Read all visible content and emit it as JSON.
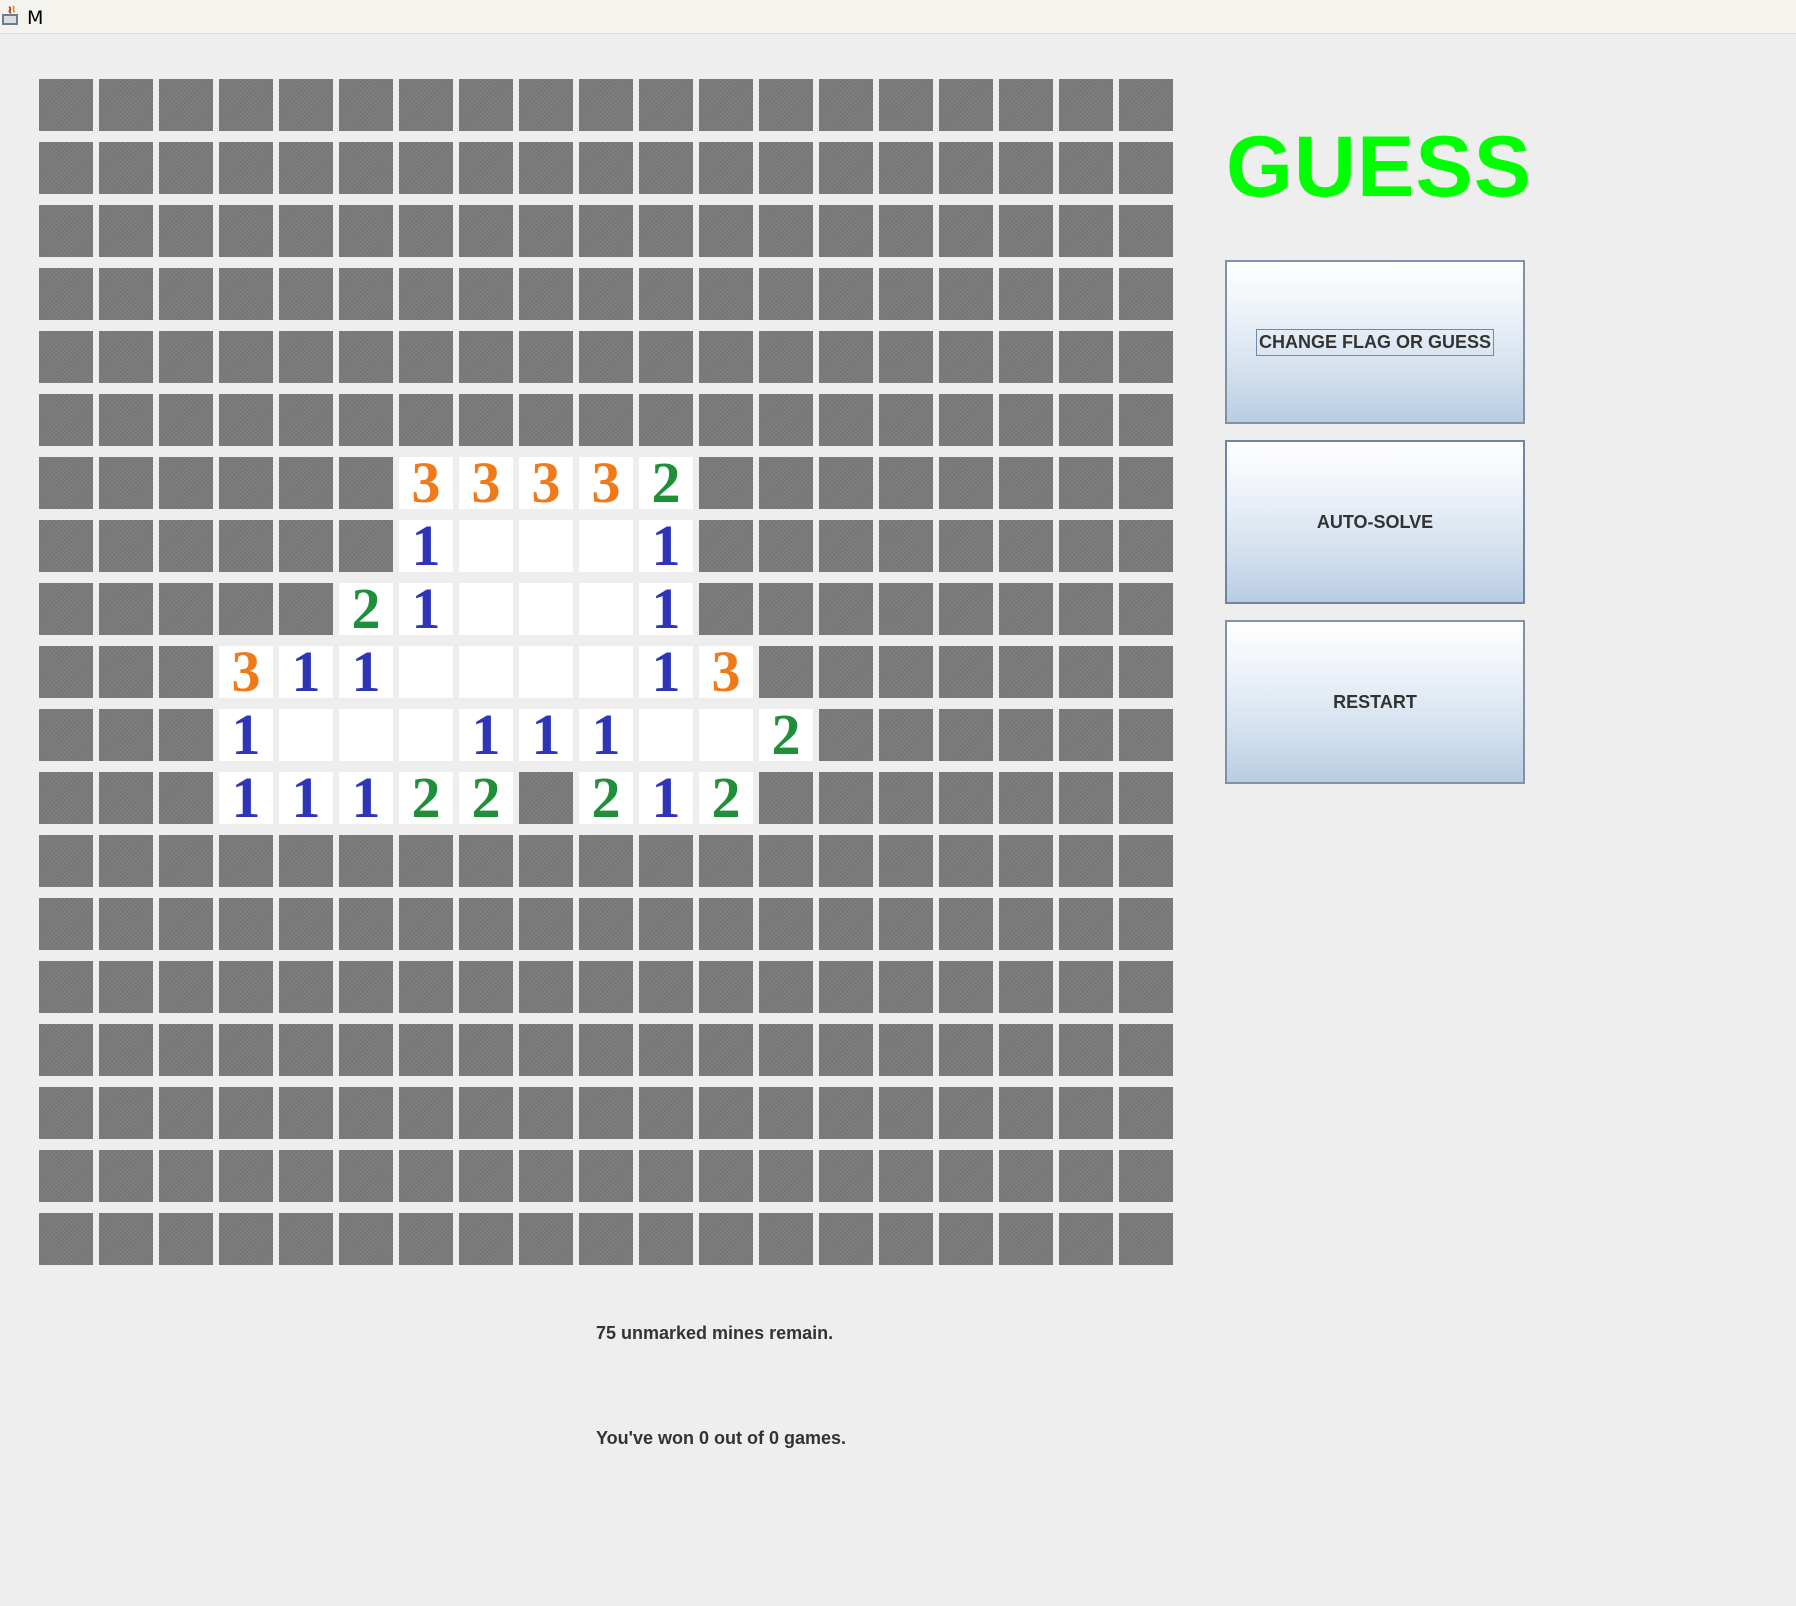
{
  "window": {
    "title": "M"
  },
  "mode": {
    "label": "GUESS",
    "color": "#00ff00"
  },
  "buttons": {
    "flag_toggle": "CHANGE FLAG OR GUESS",
    "auto_solve": "AUTO-SOLVE",
    "restart": "RESTART"
  },
  "status": {
    "mines_remaining": "75 unmarked mines remain.",
    "games_won": "You've won 0 out of 0 games."
  },
  "colors": {
    "hidden_cell": "#7a7a7a",
    "open_cell": "#ffffff",
    "number_1": "#2e35b8",
    "number_2": "#1f8f3a",
    "number_3": "#f07a1a",
    "background": "#eeeeee"
  },
  "board": {
    "rows": 19,
    "cols": 19,
    "legend": "H = hidden cell, 0 = opened blank cell, 1-3 = opened cell with adjacent mine count",
    "cells": [
      "HHHHHHHHHHHHHHHHHHH",
      "HHHHHHHHHHHHHHHHHHH",
      "HHHHHHHHHHHHHHHHHHH",
      "HHHHHHHHHHHHHHHHHHH",
      "HHHHHHHHHHHHHHHHHHH",
      "HHHHHHHHHHHHHHHHHHH",
      "HHHHHH33332HHHHHHHH",
      "HHHHHH10001HHHHHHHH",
      "HHHHH210001HHHHHHHH",
      "HHH311000013HHHHHHH",
      "HHH1000111002HHHHHH",
      "HHH11122H212HHHHHHH",
      "HHHHHHHHHHHHHHHHHHH",
      "HHHHHHHHHHHHHHHHHHH",
      "HHHHHHHHHHHHHHHHHHH",
      "HHHHHHHHHHHHHHHHHHH",
      "HHHHHHHHHHHHHHHHHHH",
      "HHHHHHHHHHHHHHHHHHH",
      "HHHHHHHHHHHHHHHHHHH"
    ]
  }
}
